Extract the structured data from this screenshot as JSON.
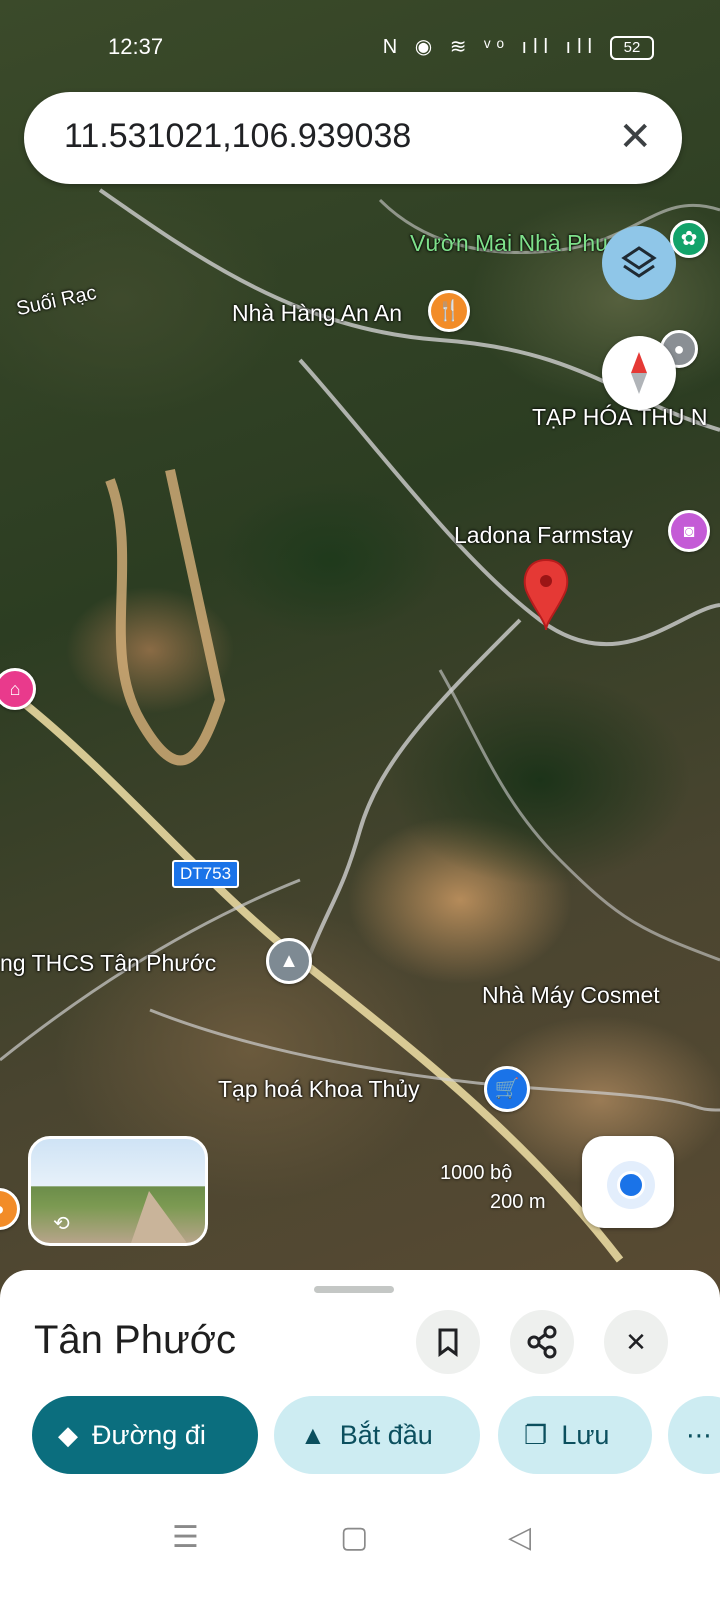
{
  "status_bar": {
    "time": "12:37",
    "icons": "N ◉ ≋ ᵛᵒ ıll ıll",
    "battery": "52"
  },
  "search": {
    "value": "11.531021,106.939038"
  },
  "map": {
    "labels": {
      "vuon_mai": "Vườn Mai Nhà Phu",
      "suoi_rac": "Suối Rạc",
      "nha_hang": "Nhà Hàng An An",
      "tap_hoa_thu": "TẠP HÓA THU N",
      "ladona": "Ladona Farmstay",
      "thcs": "ng THCS Tân Phước",
      "nha_may": "Nhà Máy Cosmet",
      "tap_hoa_khoa": "Tạp hoá Khoa Thủy"
    },
    "road_shield": "DT753",
    "scale": {
      "feet": "1000 bộ",
      "meters": "200 m"
    }
  },
  "place": {
    "title": "Tân Phước",
    "actions": [
      {
        "label": "Đường đi",
        "icon": "directions-icon"
      },
      {
        "label": "Bắt đầu",
        "icon": "navigation-arrow-icon"
      },
      {
        "label": "Lưu",
        "icon": "bookmark-icon"
      }
    ]
  },
  "colors": {
    "primary": "#0b6e7e",
    "secondary": "#cdecf2",
    "pin": "#e53935",
    "accent": "#1a73e8"
  }
}
